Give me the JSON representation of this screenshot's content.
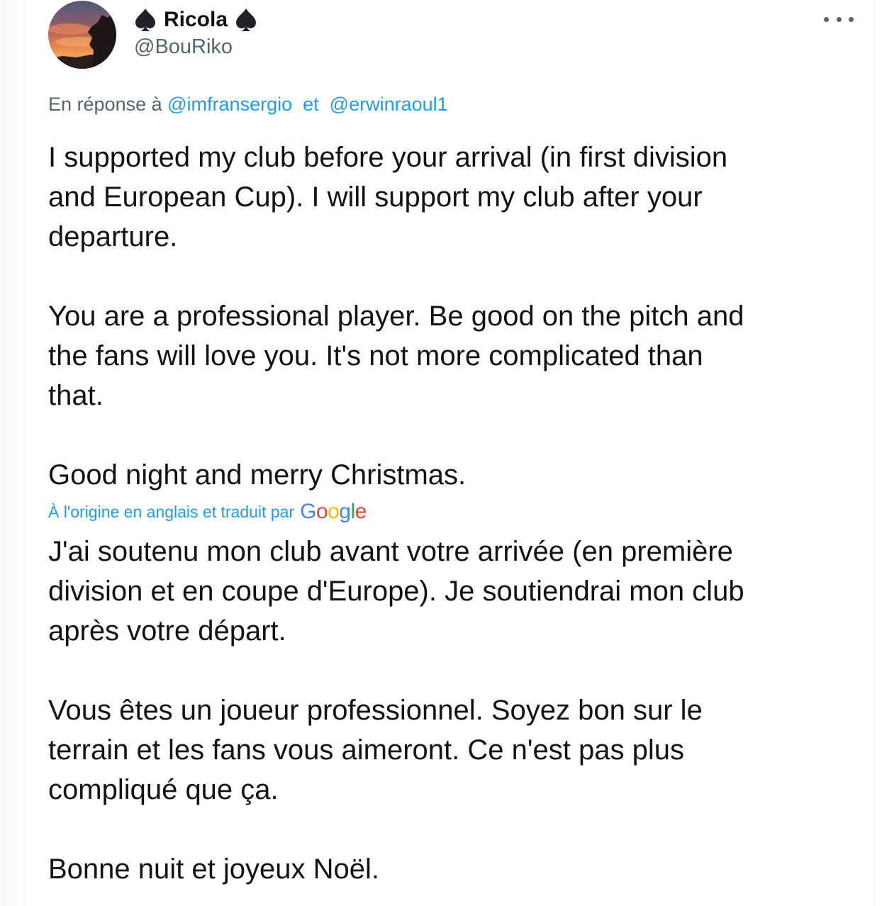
{
  "tweet": {
    "display_name": "Ricola",
    "name_emoji": "spade-suit",
    "handle": "@BouRiko",
    "more_icon": "more-dots-icon",
    "reply": {
      "prefix": "En réponse à",
      "mention_1": "@imfransergio",
      "separator": "et",
      "mention_2": "@erwinraoul1"
    },
    "original_paragraphs": [
      "I supported my club before your arrival (in first division\nand European Cup). I will support my club after your\ndeparture.",
      "You are a professional player. Be good on the pitch and\nthe fans will love you. It's not more complicated than\nthat.",
      "Good night and merry Christmas."
    ],
    "translation": {
      "label": "À l'origine en anglais et traduit par",
      "provider": "Google",
      "paragraphs": [
        "J'ai soutenu mon club avant votre arrivée (en première\ndivision et en coupe d'Europe). Je soutiendrai mon club\naprès votre départ.",
        "Vous êtes un joueur professionnel. Soyez bon sur le\nterrain et les fans vous aimeront. Ce n'est pas plus\ncompliqué que ça.",
        "Bonne nuit et joyeux Noël."
      ]
    }
  },
  "colors": {
    "text": "#0f1419",
    "secondary": "#536471",
    "link": "#1d9bf0",
    "border": "#eff3f4"
  }
}
